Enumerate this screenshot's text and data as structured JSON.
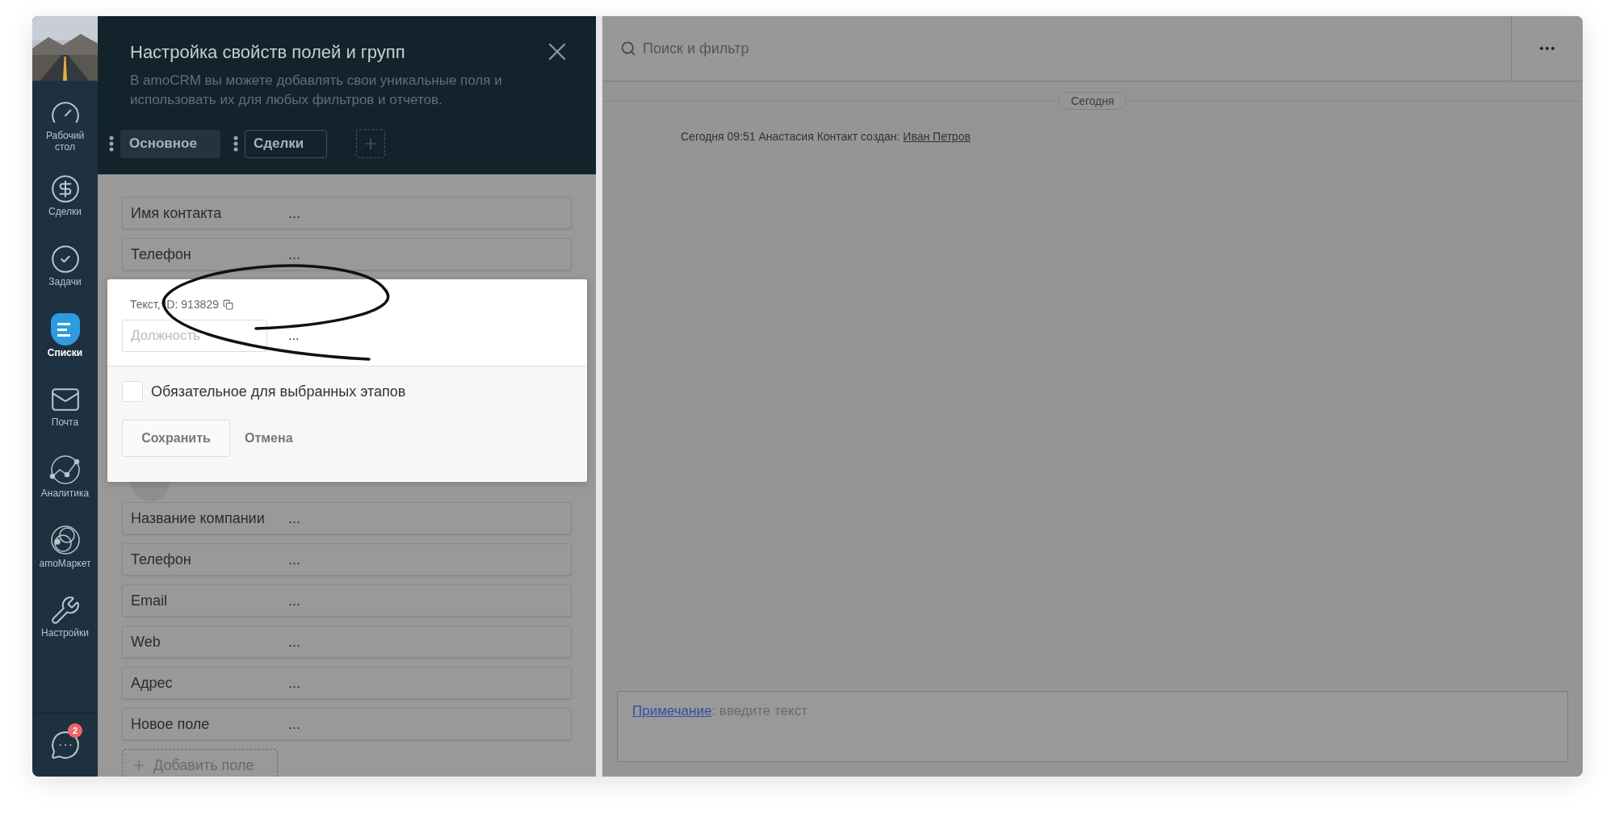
{
  "sidebar": {
    "items": [
      {
        "label": "Рабочий стол",
        "kind": "dashboard",
        "selected": false
      },
      {
        "label": "Сделки",
        "kind": "deals",
        "selected": false
      },
      {
        "label": "Задачи",
        "kind": "tasks",
        "selected": false
      },
      {
        "label": "Списки",
        "kind": "lists",
        "selected": true
      },
      {
        "label": "Почта",
        "kind": "mail",
        "selected": false
      },
      {
        "label": "Аналитика",
        "kind": "analytics",
        "selected": false
      },
      {
        "label": "amoМаркет",
        "kind": "market",
        "selected": false
      },
      {
        "label": "Настройки",
        "kind": "settings",
        "selected": false
      }
    ],
    "chat": {
      "badge": "2"
    }
  },
  "panel": {
    "title": "Настройка свойств полей и групп",
    "subtitle": "В amoCRM вы можете добавлять свои уникальные поля и использовать их для любых фильтров и отчетов.",
    "tabs": [
      {
        "label": "Основное",
        "selected": true
      },
      {
        "label": "Сделки",
        "selected": false
      }
    ],
    "contact_fields": [
      {
        "name": "Имя контакта",
        "more": "..."
      },
      {
        "name": "Телефон",
        "more": "..."
      }
    ],
    "company_section": {
      "fields": [
        {
          "name": "Название компании",
          "more": "..."
        },
        {
          "name": "Телефон",
          "more": "..."
        },
        {
          "name": "Email",
          "more": "..."
        },
        {
          "name": "Web",
          "more": "..."
        },
        {
          "name": "Адрес",
          "more": "..."
        },
        {
          "name": "Новое поле",
          "more": "..."
        }
      ],
      "add_button": "Добавить поле"
    }
  },
  "editor": {
    "type_label": "Текст, ID: 913829",
    "name_placeholder": "Должность",
    "more": "...",
    "required": {
      "label": "Обязательное для выбранных этапов",
      "checked": false
    },
    "save": "Сохранить",
    "cancel": "Отмена"
  },
  "feed": {
    "search_placeholder": "Поиск и фильтр",
    "date_badge": "Сегодня",
    "events": [
      {
        "text": "Сегодня 09:51 Анастасия Контакт создан:",
        "link": "Иван Петров"
      }
    ],
    "note": {
      "link": "Примечание",
      "placeholder": ": введите текст"
    }
  }
}
